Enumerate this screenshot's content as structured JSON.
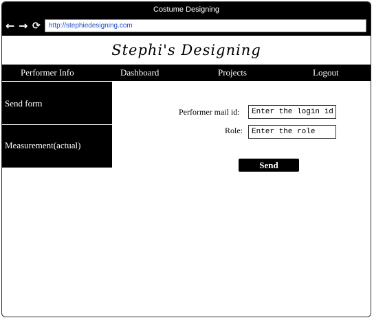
{
  "window": {
    "title": "Costume Designing"
  },
  "browser": {
    "url": "http://stephiedesigning.com"
  },
  "header": {
    "logo_text": "Stephi's Designing"
  },
  "menu": {
    "performer_info": "Performer Info",
    "dashboard": "Dashboard",
    "projects": "Projects",
    "logout": "Logout"
  },
  "sidebar": {
    "items": [
      {
        "label": "Send form"
      },
      {
        "label": "Measurement(actual)"
      }
    ]
  },
  "form": {
    "mail_label": "Performer mail id:",
    "mail_placeholder": "Enter the login id",
    "role_label": "Role:",
    "role_placeholder": "Enter the role",
    "send_label": "Send"
  },
  "colors": {
    "bar": "#000000",
    "link": "#1d4fc4"
  },
  "icons": [
    "back-arrow-icon",
    "forward-arrow-icon",
    "refresh-icon"
  ]
}
